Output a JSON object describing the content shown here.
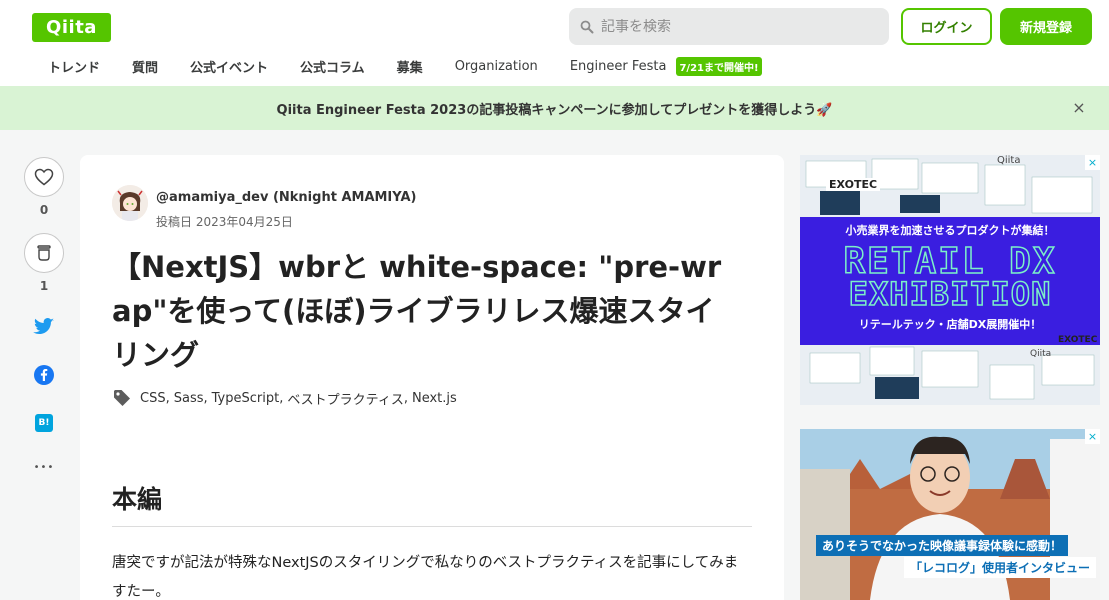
{
  "header": {
    "logo": "Qiita",
    "search_placeholder": "記事を検索",
    "login_label": "ログイン",
    "signup_label": "新規登録"
  },
  "nav": {
    "items": [
      "トレンド",
      "質問",
      "公式イベント",
      "公式コラム",
      "募集",
      "Organization",
      "Engineer Festa"
    ],
    "festa_badge": "7/21まで開催中!"
  },
  "banner": {
    "text": "Qiita Engineer Festa 2023の記事投稿キャンペーンに参加してプレゼントを獲得しよう🚀",
    "close": "×"
  },
  "actions": {
    "like_count": "0",
    "stock_count": "1",
    "hatena_label": "B!",
    "more": "•••"
  },
  "article": {
    "author": "@amamiya_dev (Nknight AMAMIYA)",
    "posted": "投稿日 2023年04月25日",
    "title": "【NextJS】wbrと white-space: \"pre-wrap\"を使って(ほぼ)ライブラリレス爆速スタイリング",
    "tags": [
      "CSS",
      "Sass",
      "TypeScript",
      "ベストプラクティス",
      "Next.js"
    ],
    "heading": "本編",
    "paragraph": "唐突ですが記法が特殊なNextJSのスタイリングで私なりのベストプラクティスを記事にしてみますたー。"
  },
  "ads": {
    "ad1": {
      "brand": "EXOTEC",
      "qiita": "Qiita",
      "tagline": "小売業界を加速させるプロダクトが集結！",
      "line1": "RETAIL DX",
      "line2": "EXHIBITION",
      "subline": "リテールテック・店舗DX展開催中！"
    },
    "ad2": {
      "caption": "ありそうでなかった映像議事録体験に感動！",
      "sub": "「レコログ」使用者インタビュー"
    },
    "close_icon": "×",
    "colors": {
      "ad1_bg": "#3a1ee0",
      "ad1_text": "#7cf0c8",
      "brand_green": "#55c500"
    }
  }
}
